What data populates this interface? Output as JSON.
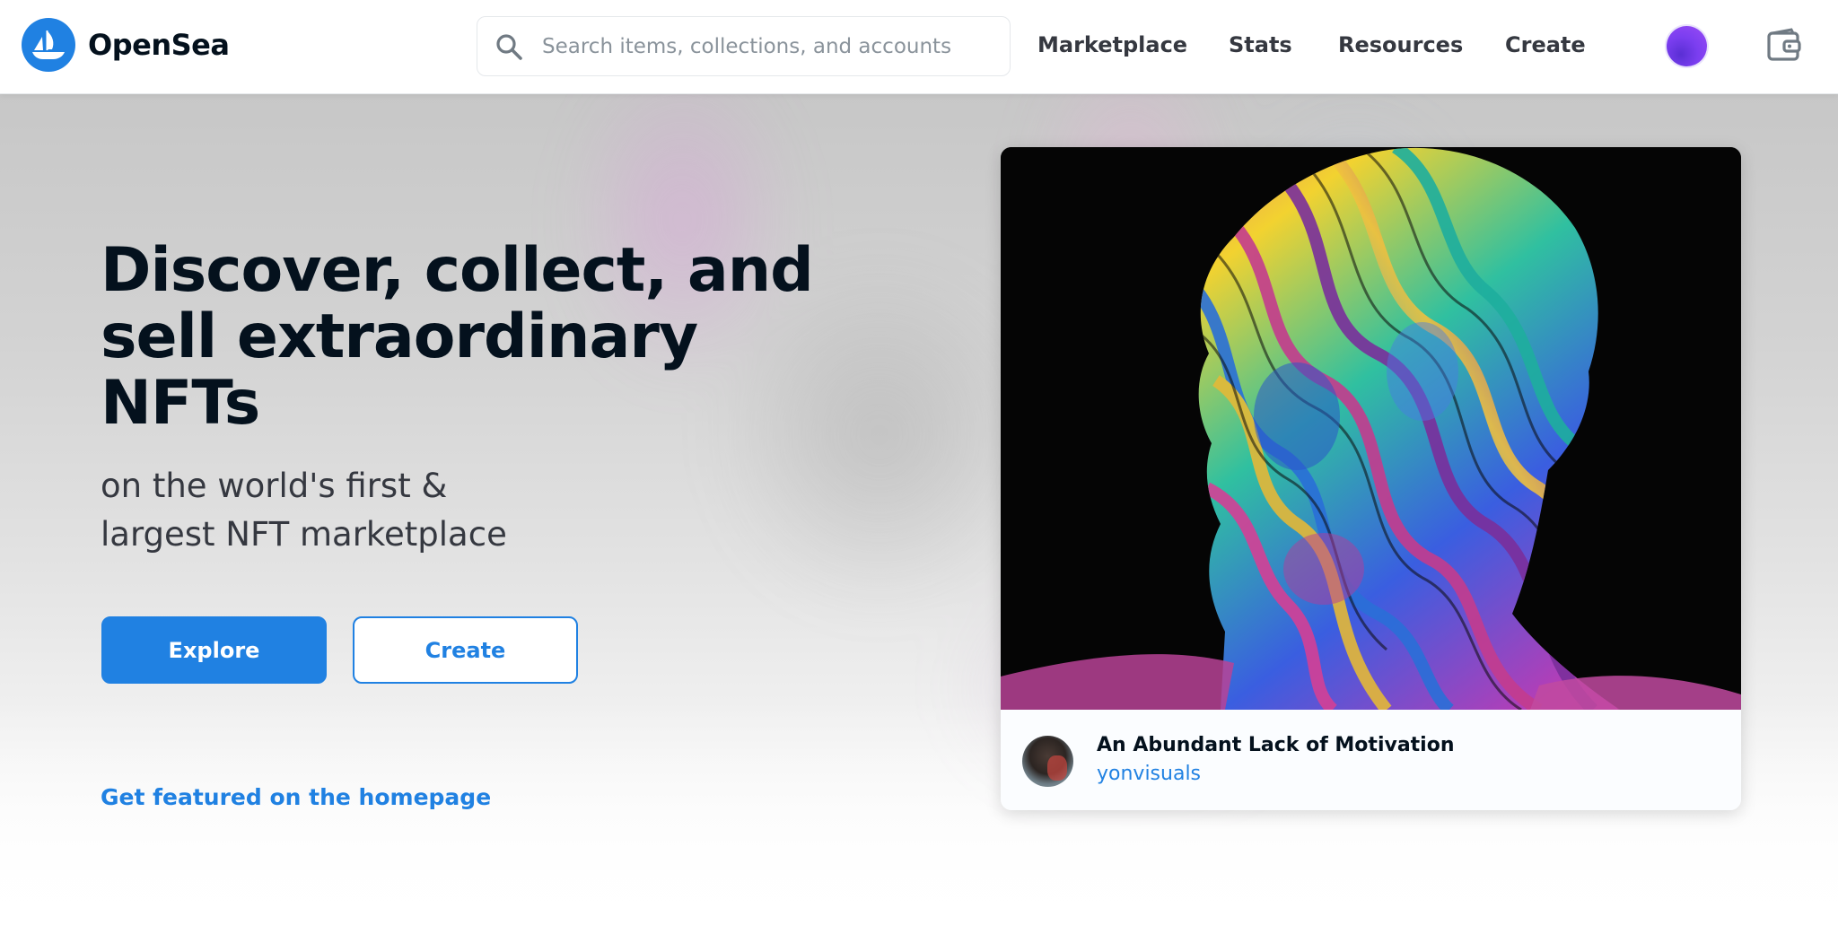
{
  "header": {
    "brand": "OpenSea",
    "search": {
      "placeholder": "Search items, collections, and accounts",
      "value": ""
    },
    "nav": [
      {
        "label": "Marketplace"
      },
      {
        "label": "Stats"
      },
      {
        "label": "Resources"
      },
      {
        "label": "Create"
      }
    ],
    "icons": {
      "logo": "opensea-ship-logo-icon",
      "search": "search-icon",
      "account": "profile-avatar-icon",
      "wallet": "wallet-icon"
    }
  },
  "hero": {
    "headline": "Discover, collect, and sell extraordinary NFTs",
    "subheadline": "on the world's first & largest NFT marketplace",
    "explore_label": "Explore",
    "create_label": "Create",
    "featured_link": "Get featured on the homepage"
  },
  "featured_card": {
    "title": "An Abundant Lack of Motivation",
    "creator": "yonvisuals"
  },
  "colors": {
    "accent": "#2081e2",
    "text": "#04111d",
    "muted": "#353840"
  }
}
